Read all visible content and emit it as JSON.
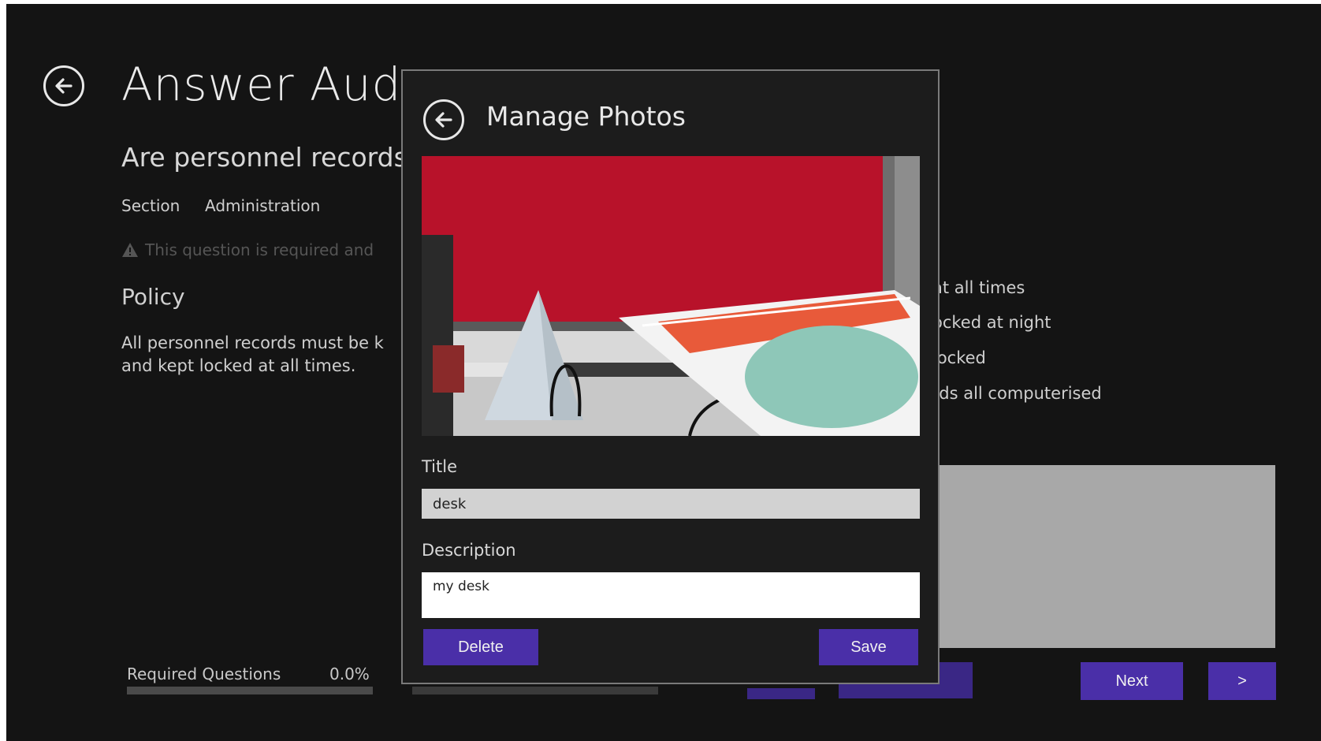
{
  "background": {
    "app_title": "Answer Aud",
    "question": "Are personnel records",
    "section_label": "Section",
    "section_value": "Administration",
    "warning_text": "This question is required and",
    "policy_heading": "Policy",
    "policy_text": "All personnel records must be k and kept locked at all times.",
    "options": [
      "at all times",
      "ocked at night",
      "locked",
      "rds all computerised"
    ],
    "required_questions_label": "Required Questions",
    "required_questions_value": "0.0%",
    "required_questions_progress": 0.0,
    "next_label": "Next",
    "last_label": ">"
  },
  "modal": {
    "title": "Manage Photos",
    "title_label": "Title",
    "title_value": "desk",
    "description_label": "Description",
    "description_value": "my desk",
    "delete_label": "Delete",
    "save_label": "Save"
  },
  "colors": {
    "background": "#141414",
    "accent": "#4a2fa8",
    "modal_background": "#1c1c1c"
  },
  "icons": [
    "back-arrow-icon",
    "warning-icon"
  ]
}
